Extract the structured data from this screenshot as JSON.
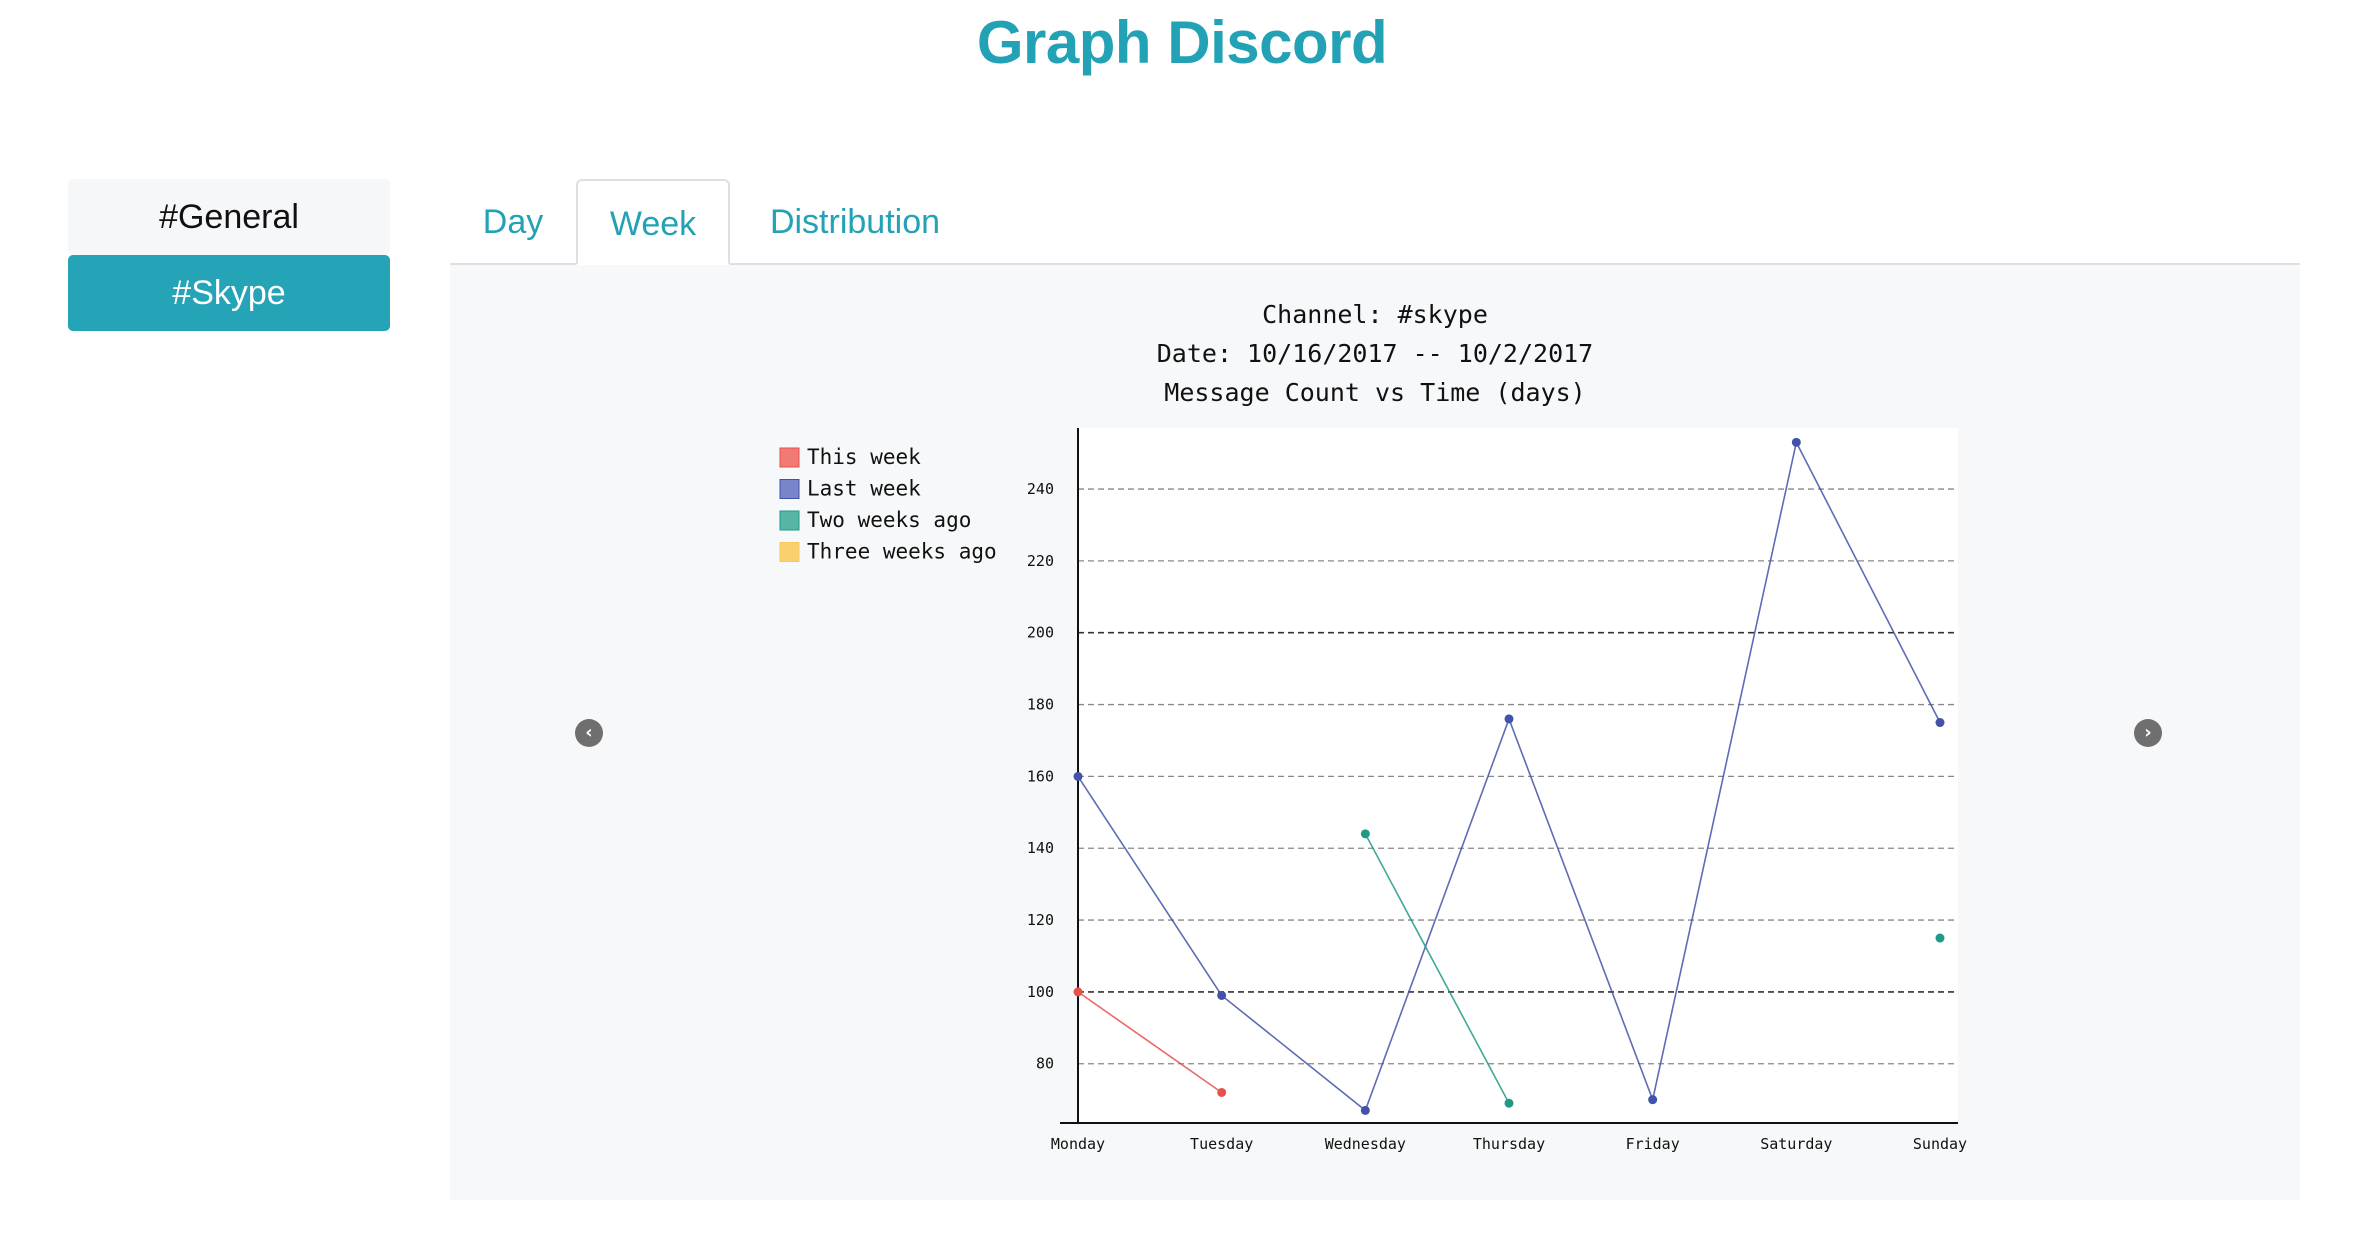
{
  "app": {
    "title": "Graph Discord"
  },
  "sidebar": {
    "channels": [
      {
        "label": "#General",
        "active": false
      },
      {
        "label": "#Skype",
        "active": true
      }
    ]
  },
  "tabs": [
    {
      "label": "Day",
      "active": false
    },
    {
      "label": "Week",
      "active": true
    },
    {
      "label": "Distribution",
      "active": false
    }
  ],
  "carousel": {
    "prev_icon": "chevron-left-icon",
    "next_icon": "chevron-right-icon"
  },
  "colors": {
    "accent": "#24a2b5",
    "this_week": "#e8504a",
    "last_week": "#4252a8",
    "two_weeks_ago": "#1f9a86",
    "three_weeks_ago": "#f7c85b"
  },
  "chart_data": {
    "type": "line",
    "title_lines": [
      "Channel: #skype",
      "Date: 10/16/2017 -- 10/2/2017",
      "Message Count vs Time (days)"
    ],
    "categories": [
      "Monday",
      "Tuesday",
      "Wednesday",
      "Thursday",
      "Friday",
      "Saturday",
      "Sunday"
    ],
    "yticks": [
      80,
      100,
      120,
      140,
      160,
      180,
      200,
      220,
      240
    ],
    "ylim": [
      63.5,
      257
    ],
    "grid": true,
    "legend_position": "top-left",
    "series": [
      {
        "name": "This week",
        "color": "#e8504a",
        "legend_color": "#f17a75",
        "values": [
          100,
          72,
          null,
          null,
          null,
          null,
          null
        ]
      },
      {
        "name": "Last week",
        "color": "#4252a8",
        "legend_color": "#7886c9",
        "values": [
          160,
          99,
          67,
          176,
          70,
          253,
          175
        ]
      },
      {
        "name": "Two weeks ago",
        "color": "#1f9a86",
        "legend_color": "#57b5a6",
        "values": [
          null,
          null,
          144,
          69,
          null,
          null,
          115
        ]
      },
      {
        "name": "Three weeks ago",
        "color": "#f7c85b",
        "legend_color": "#f9d06e",
        "values": [
          null,
          null,
          null,
          null,
          null,
          null,
          null
        ]
      }
    ]
  }
}
